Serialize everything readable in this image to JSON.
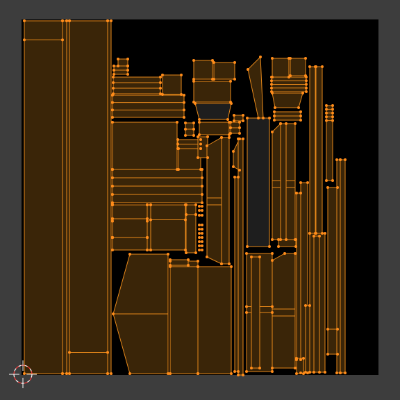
{
  "editor": {
    "type": "uv-editor",
    "background_color": "#3d3d3d",
    "image_background_color": "#000000",
    "face_fill_color": "#3a2508",
    "face_dark_fill_color": "#1e1e1e",
    "edge_color": "#e8891a",
    "vertex_color": "#ff8c1a",
    "cursor_icon": "2d-cursor-icon",
    "uv_islands_visible": true,
    "selection": "all"
  }
}
